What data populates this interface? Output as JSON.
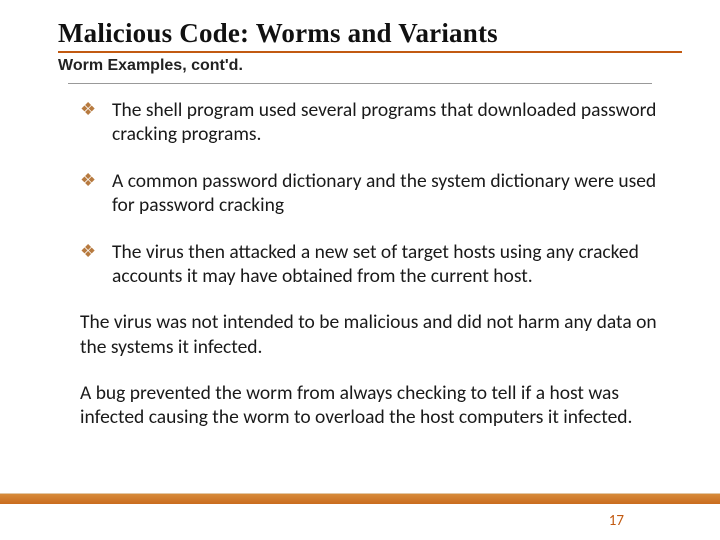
{
  "title": "Malicious Code: Worms and Variants",
  "subtitle": "Worm Examples, cont'd.",
  "bullets": [
    "The shell program used several programs that downloaded password cracking programs.",
    "A common password dictionary and the system dictionary were used for password cracking",
    "The virus then attacked a new set of target hosts using any cracked accounts it may have obtained from the current host."
  ],
  "paragraphs": [
    "The virus was not intended to be malicious and did not harm any data on the systems it infected.",
    "A bug prevented the worm from always checking to tell if a host was infected causing the worm to overload the host computers it infected."
  ],
  "bullet_glyph": "❖",
  "page_number": "17"
}
